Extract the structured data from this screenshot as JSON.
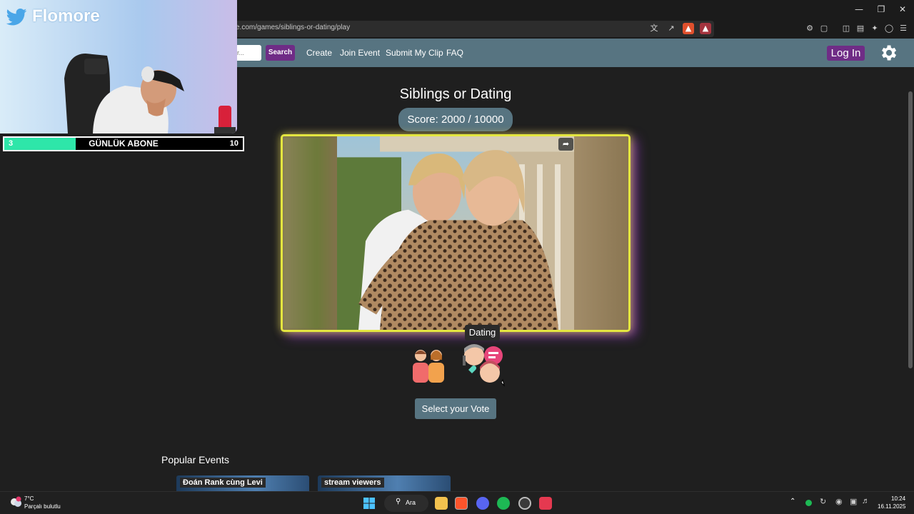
{
  "browser": {
    "url": "e.com/games/siblings-or-dating/play",
    "window_controls": [
      "minimize-icon",
      "restore-icon",
      "close-icon"
    ]
  },
  "navbar": {
    "search_placeholder": "r...",
    "search_label": "Search",
    "links": [
      "Create",
      "Join Event",
      "Submit My Clip",
      "FAQ"
    ],
    "login_label": "Log In"
  },
  "game": {
    "title": "Siblings or Dating",
    "score_text": "Score: 2000 / 10000",
    "tooltip": "Dating",
    "options": [
      "siblings-icon",
      "dating-icon"
    ],
    "vote_button": "Select your Vote"
  },
  "events": {
    "section_title": "Popular Events",
    "cards": [
      "Đoán Rank cùng Levi",
      "stream viewers"
    ]
  },
  "overlay": {
    "channel_name": "Flomore",
    "sub_goal_label": "GÜNLÜK ABONE",
    "sub_current": "3",
    "sub_goal": "10",
    "sub_progress": 0.3
  },
  "taskbar": {
    "weather_temp": "7°C",
    "weather_desc": "Parçalı bulutlu",
    "search_label": "Ara",
    "time": "10:24",
    "date": "16.11.2025"
  },
  "colors": {
    "accent_purple": "#6f2c86",
    "navbar": "#577481",
    "sub_fill": "#2ee6a9"
  }
}
